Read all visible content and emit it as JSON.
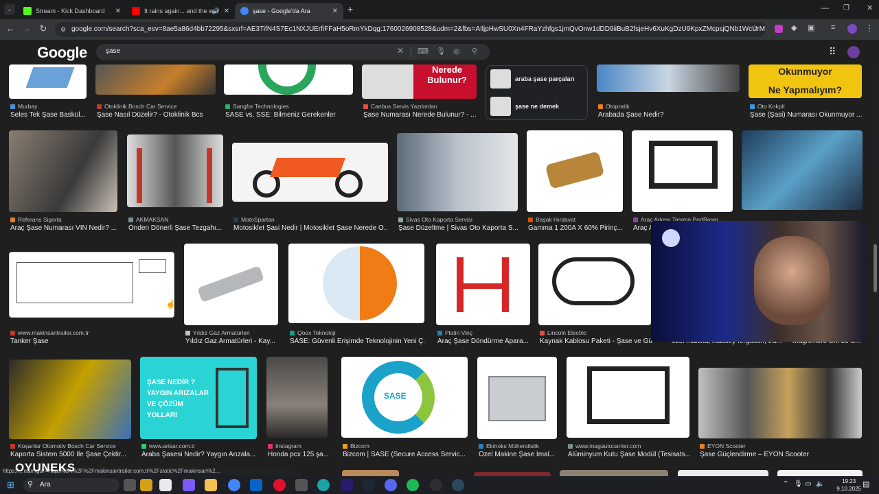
{
  "tabs": [
    {
      "title": "Stream - Kick Dashboard",
      "favicon_color": "#53fc18"
    },
    {
      "title": "It rains again... and the wor",
      "favicon_color": "#ff0000"
    },
    {
      "title": "şase - Google'da Ara",
      "favicon_color": "#4285f4"
    }
  ],
  "address": {
    "url": "google.com/search?sca_esv=8ae5a86d4bb72295&sxsrf=AE3TifN4S7Ec1NXJUErfiFFaH5oRmYkDqg:1760026908528&udm=2&fbs=AIljpHwSU0Xn4FRaYzhfgs1jmQvOnw1dDD9iiBuB2fsjeHv6XuKgDzU9KpxZMcpsjQNb1WcUrMDj8VH-V1nllc..."
  },
  "google": {
    "logo": "Google",
    "query": "şase"
  },
  "related": [
    {
      "text": "araba şase parçaları"
    },
    {
      "text": "şase ne demek"
    }
  ],
  "row1": [
    {
      "source": "Murbay",
      "title": "Seles Tek Şase Baskül...",
      "color": "#4a90d9"
    },
    {
      "source": "Otoklinik Bosch Car Service",
      "title": "Şase Nasıl Düzelir? - Otoklinik Bcs",
      "color": "#c0392b"
    },
    {
      "source": "Sangfor Technologies",
      "title": "SASE vs. SSE: Bilmeniz Gerekenler",
      "color": "#27ae60"
    },
    {
      "source": "Canbus Servis Yazılımları",
      "title": "Şase Numarası Nerede Bulunur? - ...",
      "color": "#e74c3c"
    },
    {
      "source": "Otopratik",
      "title": "Arabada Şase Nedir?",
      "color": "#e67e22"
    },
    {
      "source": "Oto Kokpit",
      "title": "Şase (Şasi) Numarası Okunmuyor ...",
      "color": "#3498db"
    }
  ],
  "row2": [
    {
      "source": "Referans Sigorta",
      "title": "Araç Şase Numarası VIN Nedir? ...",
      "color": "#e67e22"
    },
    {
      "source": "AKMAKSAN",
      "title": "Önden Dönerli Şase Tezgahı...",
      "color": "#7f8c8d"
    },
    {
      "source": "MotoSpartan",
      "title": "Motosiklet Şasi Nedir | Motosiklet Şase Nerede O...",
      "color": "#2c3e50"
    },
    {
      "source": "Sivas Oto Kaporta Servisi",
      "title": "Şase Düzeltme | Sivas Oto Kaporta S...",
      "color": "#95a5a6"
    },
    {
      "source": "Başak Hırdavat",
      "title": "Gamma 1 200A X 60% Pirinç...",
      "color": "#d35400"
    },
    {
      "source": "Araç Arkası Taşıma PortBagaj",
      "title": "Araç A...",
      "color": "#8e44ad"
    }
  ],
  "row3": [
    {
      "source": "www.makinsantrailer.com.tr",
      "title": "Tanker Şase",
      "color": "#c0392b"
    },
    {
      "source": "Yıldız Gaz Armatürleri",
      "title": "Yıldız Gaz Armatürleri - Kay...",
      "color": "#bdc3c7"
    },
    {
      "source": "Qoex Teknoloji",
      "title": "SASE: Güvenli Erişimde Teknolojinin Yeni Ç...",
      "color": "#16a085"
    },
    {
      "source": "Platin Vinç",
      "title": "Araç Şase Döndürme Apara...",
      "color": "#2980b9"
    },
    {
      "source": "Lincoln Electric",
      "title": "Kaynak Kablosu Paketi - Şase ve Güç...",
      "color": "#e74c3c"
    }
  ],
  "row4": [
    {
      "source": "Koşanlar Otomotiv Bosch Car Service",
      "title": "Kaporta Sistem 5000 İle Şase Çektir...",
      "color": "#c0392b"
    },
    {
      "source": "www.arisar.com.tr",
      "title": "Araba Şasesi Nedir? Yaygın Arızala...",
      "color": "#2ecc71"
    },
    {
      "source": "Instagram",
      "title": "Honda pcx 125 şa...",
      "color": "#e1306c"
    },
    {
      "source": "Bizcom",
      "title": "Bizcom | SASE (Secure Access Servic...",
      "color": "#f39c12"
    },
    {
      "source": "Ekinoks Mühendislik",
      "title": "Özel Makine Şase İmal...",
      "color": "#2980b9"
    },
    {
      "source": "www.magautocarrier.com",
      "title": "Alüminyum Kutu Şase Modül (Tesisats...",
      "color": "#7f8c8d"
    },
    {
      "source": "EYON Scooter",
      "title": "Şase Güçlendirme – EYON Scooter",
      "color": "#e67e22"
    }
  ],
  "partial_row": {
    "text1": "özel makina, massey ferguson, tra...",
    "text2": "Magnimore SM 50 S..."
  },
  "status_url": "https://...e&imgurl=https%3A%2F%2Fmakinsantrailer.com.tr%2Fstatic%2Fmakinsan%2...",
  "overlay_logo": "OYUNEKS",
  "taskbar": {
    "search": "Ara",
    "time": "19:23",
    "date": "9.10.2025"
  }
}
